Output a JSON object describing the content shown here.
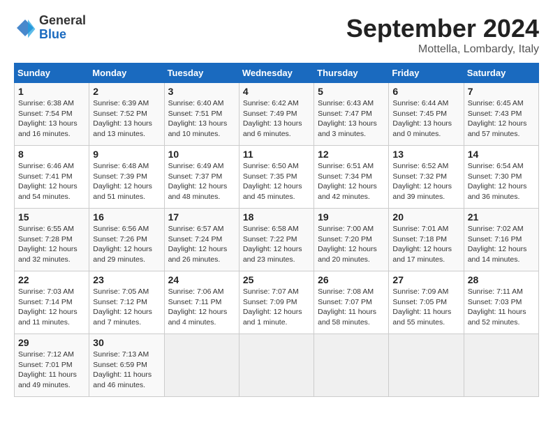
{
  "header": {
    "logo_general": "General",
    "logo_blue": "Blue",
    "month_title": "September 2024",
    "subtitle": "Mottella, Lombardy, Italy"
  },
  "days_of_week": [
    "Sunday",
    "Monday",
    "Tuesday",
    "Wednesday",
    "Thursday",
    "Friday",
    "Saturday"
  ],
  "weeks": [
    [
      {
        "day": "1",
        "info": "Sunrise: 6:38 AM\nSunset: 7:54 PM\nDaylight: 13 hours\nand 16 minutes."
      },
      {
        "day": "2",
        "info": "Sunrise: 6:39 AM\nSunset: 7:52 PM\nDaylight: 13 hours\nand 13 minutes."
      },
      {
        "day": "3",
        "info": "Sunrise: 6:40 AM\nSunset: 7:51 PM\nDaylight: 13 hours\nand 10 minutes."
      },
      {
        "day": "4",
        "info": "Sunrise: 6:42 AM\nSunset: 7:49 PM\nDaylight: 13 hours\nand 6 minutes."
      },
      {
        "day": "5",
        "info": "Sunrise: 6:43 AM\nSunset: 7:47 PM\nDaylight: 13 hours\nand 3 minutes."
      },
      {
        "day": "6",
        "info": "Sunrise: 6:44 AM\nSunset: 7:45 PM\nDaylight: 13 hours\nand 0 minutes."
      },
      {
        "day": "7",
        "info": "Sunrise: 6:45 AM\nSunset: 7:43 PM\nDaylight: 12 hours\nand 57 minutes."
      }
    ],
    [
      {
        "day": "8",
        "info": "Sunrise: 6:46 AM\nSunset: 7:41 PM\nDaylight: 12 hours\nand 54 minutes."
      },
      {
        "day": "9",
        "info": "Sunrise: 6:48 AM\nSunset: 7:39 PM\nDaylight: 12 hours\nand 51 minutes."
      },
      {
        "day": "10",
        "info": "Sunrise: 6:49 AM\nSunset: 7:37 PM\nDaylight: 12 hours\nand 48 minutes."
      },
      {
        "day": "11",
        "info": "Sunrise: 6:50 AM\nSunset: 7:35 PM\nDaylight: 12 hours\nand 45 minutes."
      },
      {
        "day": "12",
        "info": "Sunrise: 6:51 AM\nSunset: 7:34 PM\nDaylight: 12 hours\nand 42 minutes."
      },
      {
        "day": "13",
        "info": "Sunrise: 6:52 AM\nSunset: 7:32 PM\nDaylight: 12 hours\nand 39 minutes."
      },
      {
        "day": "14",
        "info": "Sunrise: 6:54 AM\nSunset: 7:30 PM\nDaylight: 12 hours\nand 36 minutes."
      }
    ],
    [
      {
        "day": "15",
        "info": "Sunrise: 6:55 AM\nSunset: 7:28 PM\nDaylight: 12 hours\nand 32 minutes."
      },
      {
        "day": "16",
        "info": "Sunrise: 6:56 AM\nSunset: 7:26 PM\nDaylight: 12 hours\nand 29 minutes."
      },
      {
        "day": "17",
        "info": "Sunrise: 6:57 AM\nSunset: 7:24 PM\nDaylight: 12 hours\nand 26 minutes."
      },
      {
        "day": "18",
        "info": "Sunrise: 6:58 AM\nSunset: 7:22 PM\nDaylight: 12 hours\nand 23 minutes."
      },
      {
        "day": "19",
        "info": "Sunrise: 7:00 AM\nSunset: 7:20 PM\nDaylight: 12 hours\nand 20 minutes."
      },
      {
        "day": "20",
        "info": "Sunrise: 7:01 AM\nSunset: 7:18 PM\nDaylight: 12 hours\nand 17 minutes."
      },
      {
        "day": "21",
        "info": "Sunrise: 7:02 AM\nSunset: 7:16 PM\nDaylight: 12 hours\nand 14 minutes."
      }
    ],
    [
      {
        "day": "22",
        "info": "Sunrise: 7:03 AM\nSunset: 7:14 PM\nDaylight: 12 hours\nand 11 minutes."
      },
      {
        "day": "23",
        "info": "Sunrise: 7:05 AM\nSunset: 7:12 PM\nDaylight: 12 hours\nand 7 minutes."
      },
      {
        "day": "24",
        "info": "Sunrise: 7:06 AM\nSunset: 7:11 PM\nDaylight: 12 hours\nand 4 minutes."
      },
      {
        "day": "25",
        "info": "Sunrise: 7:07 AM\nSunset: 7:09 PM\nDaylight: 12 hours\nand 1 minute."
      },
      {
        "day": "26",
        "info": "Sunrise: 7:08 AM\nSunset: 7:07 PM\nDaylight: 11 hours\nand 58 minutes."
      },
      {
        "day": "27",
        "info": "Sunrise: 7:09 AM\nSunset: 7:05 PM\nDaylight: 11 hours\nand 55 minutes."
      },
      {
        "day": "28",
        "info": "Sunrise: 7:11 AM\nSunset: 7:03 PM\nDaylight: 11 hours\nand 52 minutes."
      }
    ],
    [
      {
        "day": "29",
        "info": "Sunrise: 7:12 AM\nSunset: 7:01 PM\nDaylight: 11 hours\nand 49 minutes."
      },
      {
        "day": "30",
        "info": "Sunrise: 7:13 AM\nSunset: 6:59 PM\nDaylight: 11 hours\nand 46 minutes."
      },
      {
        "day": "",
        "info": ""
      },
      {
        "day": "",
        "info": ""
      },
      {
        "day": "",
        "info": ""
      },
      {
        "day": "",
        "info": ""
      },
      {
        "day": "",
        "info": ""
      }
    ]
  ]
}
